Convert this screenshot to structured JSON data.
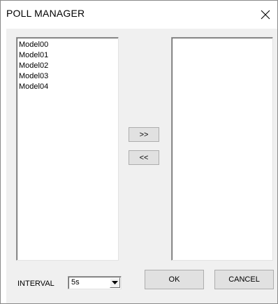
{
  "window": {
    "title": "POLL MANAGER"
  },
  "icons": {
    "close": "close-icon",
    "dropdown": "chevron-down-icon"
  },
  "available_list": {
    "items": [
      "Model00",
      "Model01",
      "Model02",
      "Model03",
      "Model04"
    ]
  },
  "selected_list": {
    "items": []
  },
  "buttons": {
    "move_right_label": ">>",
    "move_left_label": "<<",
    "ok_label": "OK",
    "cancel_label": "CANCEL"
  },
  "interval": {
    "label": "INTERVAL",
    "selected_value": "5s"
  }
}
